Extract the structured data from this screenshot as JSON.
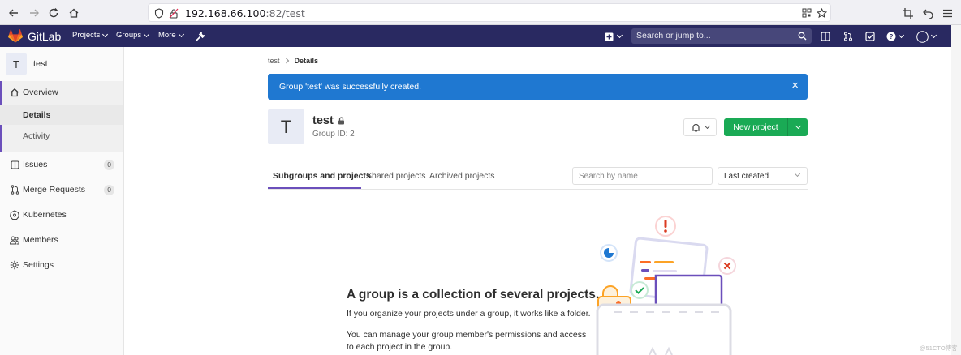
{
  "browser": {
    "url_host": "192.168.66.100",
    "url_rest": ":82/test"
  },
  "navbar": {
    "logo_text": "GitLab",
    "menu": [
      "Projects",
      "Groups",
      "More"
    ],
    "search_placeholder": "Search or jump to..."
  },
  "sidebar": {
    "avatar_letter": "T",
    "group_name": "test",
    "overview": "Overview",
    "sub_items": [
      "Details",
      "Activity"
    ],
    "items": [
      {
        "label": "Issues",
        "count": "0",
        "icon": "issues-icon"
      },
      {
        "label": "Merge Requests",
        "count": "0",
        "icon": "merge-request-icon"
      },
      {
        "label": "Kubernetes",
        "count": "",
        "icon": "kubernetes-icon"
      },
      {
        "label": "Members",
        "count": "",
        "icon": "members-icon"
      },
      {
        "label": "Settings",
        "count": "",
        "icon": "settings-icon"
      }
    ]
  },
  "breadcrumb": {
    "parent": "test",
    "current": "Details"
  },
  "flash": {
    "message": "Group 'test' was successfully created.",
    "close": "×"
  },
  "group": {
    "avatar_letter": "T",
    "name": "test",
    "id_text": "Group ID: 2"
  },
  "actions": {
    "new_project": "New project"
  },
  "tabs": [
    "Subgroups and projects",
    "Shared projects",
    "Archived projects"
  ],
  "filter": {
    "search_placeholder": "Search by name",
    "sort_value": "Last created"
  },
  "empty_state": {
    "title": "A group is a collection of several projects.",
    "p1": "If you organize your projects under a group, it works like a folder.",
    "p2": "You can manage your group member's permissions and access to each project in the group."
  },
  "watermark": "@51CTO博客",
  "colors": {
    "navbar": "#292961",
    "accent": "#6b4fbb",
    "flash": "#1f78d1",
    "success": "#1aaa55"
  }
}
